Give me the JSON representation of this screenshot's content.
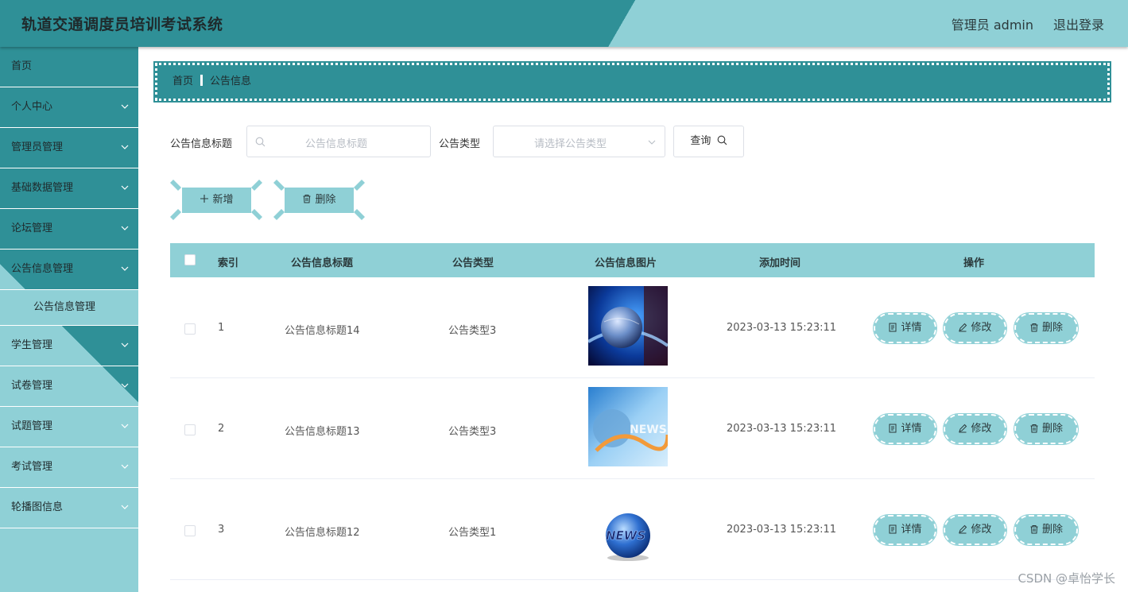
{
  "header": {
    "title": "轨道交通调度员培训考试系统",
    "admin_label": "管理员 admin",
    "logout_label": "退出登录"
  },
  "sidebar": {
    "items": [
      {
        "label": "首页",
        "has_arrow": false
      },
      {
        "label": "个人中心",
        "has_arrow": true
      },
      {
        "label": "管理员管理",
        "has_arrow": true
      },
      {
        "label": "基础数据管理",
        "has_arrow": true
      },
      {
        "label": "论坛管理",
        "has_arrow": true
      },
      {
        "label": "公告信息管理",
        "has_arrow": true,
        "expanded": true
      },
      {
        "label": "学生管理",
        "has_arrow": true
      },
      {
        "label": "试卷管理",
        "has_arrow": true
      },
      {
        "label": "试题管理",
        "has_arrow": true
      },
      {
        "label": "考试管理",
        "has_arrow": true
      },
      {
        "label": "轮播图信息",
        "has_arrow": true
      }
    ],
    "submenu": {
      "label": "公告信息管理"
    }
  },
  "breadcrumb": {
    "home": "首页",
    "current": "公告信息"
  },
  "search": {
    "title_label": "公告信息标题",
    "title_placeholder": "公告信息标题",
    "type_label": "公告类型",
    "type_placeholder": "请选择公告类型",
    "query_button": "查询"
  },
  "actions": {
    "add_label": "新增",
    "delete_label": "删除"
  },
  "table": {
    "headers": [
      "索引",
      "公告信息标题",
      "公告类型",
      "公告信息图片",
      "添加时间",
      "操作"
    ],
    "rows": [
      {
        "index": "1",
        "title": "公告信息标题14",
        "type": "公告类型3",
        "time": "2023-03-13 15:23:11",
        "image": "globe-image"
      },
      {
        "index": "2",
        "title": "公告信息标题13",
        "type": "公告类型3",
        "time": "2023-03-13 15:23:11",
        "image": "news-image"
      },
      {
        "index": "3",
        "title": "公告信息标题12",
        "type": "公告类型1",
        "time": "2023-03-13 15:23:11",
        "image": "news-globe-image"
      }
    ],
    "row_actions": {
      "detail": "详情",
      "edit": "修改",
      "delete": "删除"
    }
  },
  "watermark": "CSDN @卓怡学长",
  "colors": {
    "primary": "#2f9097",
    "light": "#8fd0d6"
  }
}
